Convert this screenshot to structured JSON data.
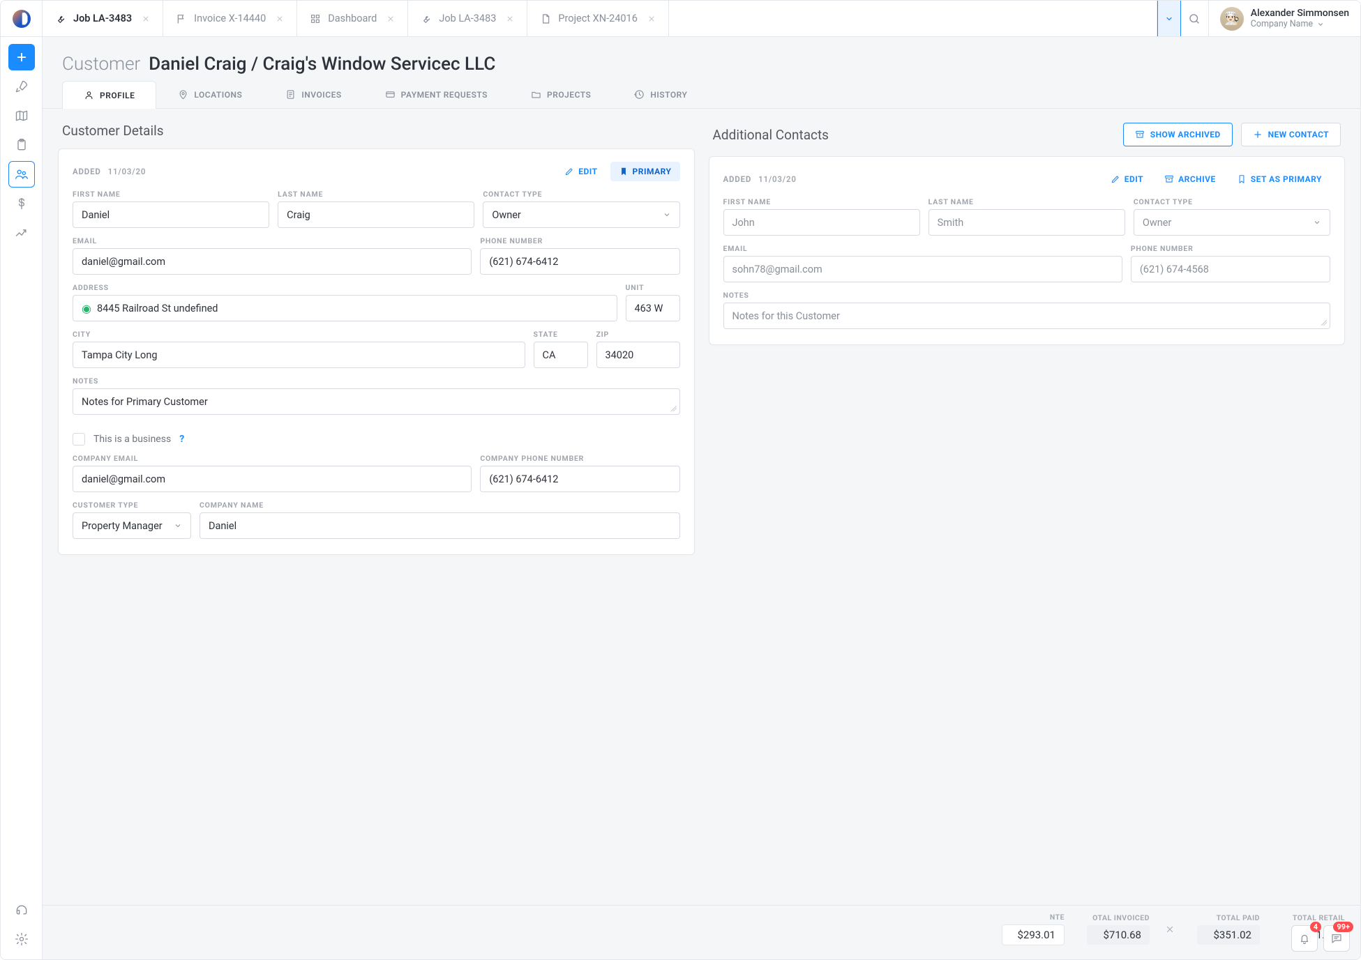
{
  "user": {
    "name": "Alexander Simmonsen",
    "company": "Company Name",
    "avatar_emoji": "👨🏻‍🍳"
  },
  "tabs": [
    {
      "icon": "wrench",
      "label": "Job LA-3483",
      "active": true
    },
    {
      "icon": "flag",
      "label": "Invoice X-14440",
      "active": false
    },
    {
      "icon": "grid",
      "label": "Dashboard",
      "active": false
    },
    {
      "icon": "wrench",
      "label": "Job LA-3483",
      "active": false
    },
    {
      "icon": "doc",
      "label": "Project XN-24016",
      "active": false
    }
  ],
  "page": {
    "crumb": "Customer",
    "title": "Daniel Craig / Craig's Window Servicec LLC"
  },
  "pageTabs": [
    {
      "icon": "user",
      "label": "PROFILE",
      "active": true
    },
    {
      "icon": "pin",
      "label": "LOCATIONS",
      "active": false
    },
    {
      "icon": "bill",
      "label": "INVOICES",
      "active": false
    },
    {
      "icon": "card",
      "label": "PAYMENT REQUESTS",
      "active": false
    },
    {
      "icon": "folder",
      "label": "PROJECTS",
      "active": false
    },
    {
      "icon": "history",
      "label": "HISTORY",
      "active": false
    }
  ],
  "left": {
    "title": "Customer Details",
    "added_label": "ADDED",
    "added_date": "11/03/20",
    "actions": {
      "edit": "EDIT",
      "primary": "PRIMARY"
    },
    "labels": {
      "first": "FIRST NAME",
      "last": "LAST NAME",
      "ctype": "CONTACT TYPE",
      "email": "EMAIL",
      "phone": "PHONE NUMBER",
      "address": "ADDRESS",
      "unit": "UNIT",
      "city": "CITY",
      "state": "STATE",
      "zip": "ZIP",
      "notes": "NOTES",
      "biz": "This is a business",
      "help": "?",
      "cemail": "COMPANY EMAIL",
      "cphone": "COMPANY PHONE NUMBER",
      "custtype": "CUSTOMER TYPE",
      "cname": "COMPANY NAME"
    },
    "values": {
      "first": "Daniel",
      "last": "Craig",
      "ctype": "Owner",
      "email": "daniel@gmail.com",
      "phone": "(621) 674-6412",
      "address": "8445 Railroad St undefined",
      "unit": "463 W",
      "city": "Tampa City Long",
      "state": "CA",
      "zip": "34020",
      "notes": "Notes for Primary Customer",
      "cemail": "daniel@gmail.com",
      "cphone": "(621) 674-6412",
      "custtype": "Property Manager",
      "cname": "Daniel"
    }
  },
  "right": {
    "title": "Additional Contacts",
    "buttons": {
      "show": "SHOW ARCHIVED",
      "new": "NEW CONTACT"
    },
    "added_label": "ADDED",
    "added_date": "11/03/20",
    "actions": {
      "edit": "EDIT",
      "archive": "ARCHIVE",
      "setprimary": "SET AS PRIMARY"
    },
    "labels": {
      "first": "FIRST NAME",
      "last": "LAST NAME",
      "ctype": "CONTACT TYPE",
      "email": "EMAIL",
      "phone": "PHONE NUMBER",
      "notes": "NOTES",
      "notes_ph": "Notes for this Customer"
    },
    "values": {
      "first": "John",
      "last": "Smith",
      "ctype": "Owner",
      "email": "sohn78@gmail.com",
      "phone": "(621) 674-4568",
      "notes": ""
    }
  },
  "footer": {
    "cols": [
      {
        "label": "NTE",
        "value": "$293.01",
        "style": "box"
      },
      {
        "label": "OTAL INVOICED",
        "value": "$710.68",
        "style": "hl",
        "closable": true
      },
      {
        "label": "TOTAL PAID",
        "value": "$351.02",
        "style": "hl"
      },
      {
        "label": "TOTAL RETAIL",
        "value": "$351.02",
        "style": ""
      }
    ]
  },
  "notif": {
    "bell": "4",
    "chat": "99+"
  }
}
